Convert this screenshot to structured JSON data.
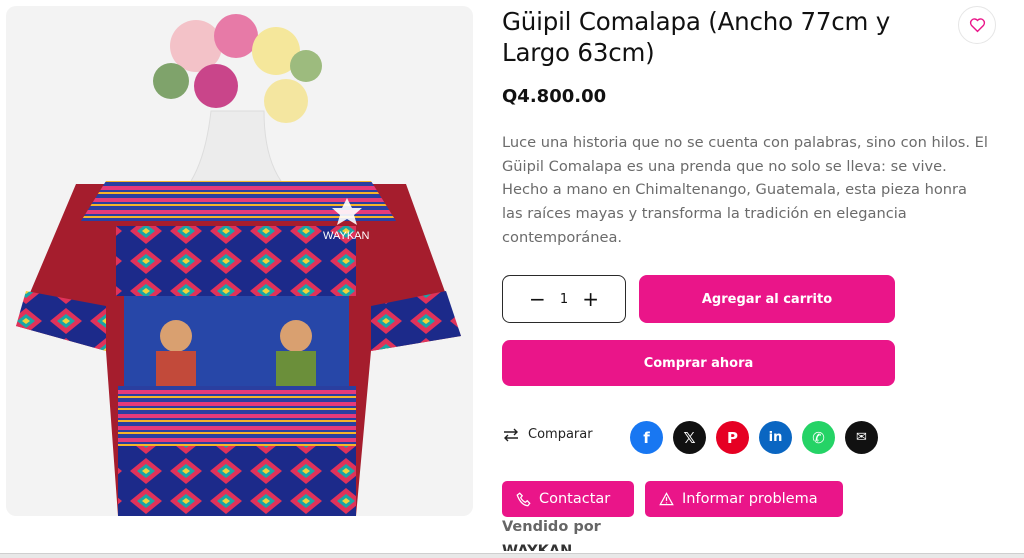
{
  "product": {
    "title": "Güipil Comalapa (Ancho 77cm y Largo 63cm)",
    "price": "Q4.800.00",
    "description": "Luce una historia que no se cuenta con palabras, sino con hilos. El Güipil Comalapa es una prenda que no solo se lleva: se vive. Hecho a mano en Chimaltenango, Guatemala, esta pieza honra las raíces mayas y transforma la tradición en elegancia contemporánea.",
    "image_watermark": "WAYKAN"
  },
  "quantity": {
    "value": "1",
    "decrement": "−",
    "increment": "+"
  },
  "actions": {
    "add_to_cart": "Agregar al carrito",
    "buy_now": "Comprar ahora",
    "compare": "Comparar",
    "contact": "Contactar",
    "report": "Informar problema"
  },
  "share": [
    {
      "name": "facebook-icon",
      "glyph": "f",
      "color": "#1877f2"
    },
    {
      "name": "x-icon",
      "glyph": "𝕏",
      "color": "#111111"
    },
    {
      "name": "pinterest-icon",
      "glyph": "P",
      "color": "#e60023"
    },
    {
      "name": "linkedin-icon",
      "glyph": "in",
      "color": "#0a66c2"
    },
    {
      "name": "whatsapp-icon",
      "glyph": "✆",
      "color": "#25d366"
    },
    {
      "name": "email-icon",
      "glyph": "✉",
      "color": "#111111"
    }
  ],
  "vendor": {
    "label": "Vendido por",
    "name": "WAYKAN"
  },
  "colors": {
    "accent": "#ea1589"
  }
}
